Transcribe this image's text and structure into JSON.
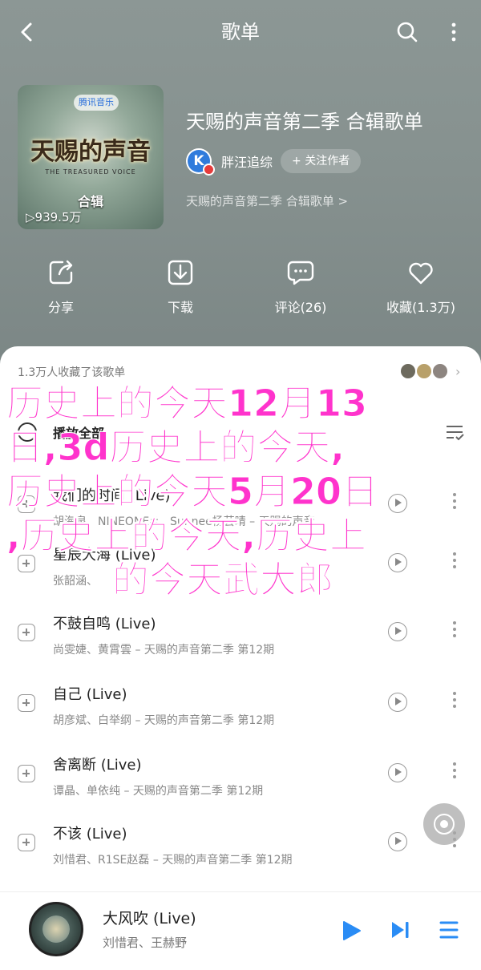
{
  "header": {
    "title": "歌单",
    "back_icon": "back-arrow-icon",
    "search_icon": "search-icon",
    "more_icon": "more-vertical-icon"
  },
  "playlist": {
    "cover": {
      "logo_text": "腾讯音乐",
      "show_title": "天赐的声音",
      "subtitle": "THE TREASURED VOICE",
      "collection": "合辑",
      "plays": "939.5万"
    },
    "title": "天赐的声音第二季 合辑歌单",
    "author_name": "胖汪追综",
    "follow_label": "+ 关注作者",
    "description": "天赐的声音第二季 合辑歌单 >"
  },
  "actions": [
    {
      "label": "分享",
      "icon": "share-icon"
    },
    {
      "label": "下载",
      "icon": "download-icon"
    },
    {
      "label": "评论(26)",
      "icon": "comment-icon"
    },
    {
      "label": "收藏(1.3万)",
      "icon": "heart-icon"
    }
  ],
  "sheet": {
    "favorited_text": "1.3万人收藏了该歌单",
    "chevron": "›",
    "play_all_label": "播放全部"
  },
  "songs": [
    {
      "title": "",
      "subtitle": ""
    },
    {
      "title": "我们的时间 (Live)",
      "subtitle": "胡海泉、NINEONE#、Sunnee杨芸晴 – 天赐的声音"
    },
    {
      "title": "星辰大海 (Live)",
      "subtitle": "张韶涵、"
    },
    {
      "title": "不鼓自鸣 (Live)",
      "subtitle": "尚雯婕、黄霄雲 – 天赐的声音第二季 第12期"
    },
    {
      "title": "自己 (Live)",
      "subtitle": "胡彦斌、白举纲 – 天赐的声音第二季 第12期"
    },
    {
      "title": "舍离断 (Live)",
      "subtitle": "谭晶、单依纯 – 天赐的声音第二季 第12期"
    },
    {
      "title": "不该 (Live)",
      "subtitle": "刘惜君、R1SE赵磊 – 天赐的声音第二季 第12期"
    }
  ],
  "now_playing": {
    "title": "大风吹 (Live)",
    "artists": "刘惜君、王赫野"
  },
  "overlay": {
    "lines": [
      "历史上的今天12月13",
      "日,3d历史上的今天,",
      "历史上的今天5月20日",
      ",历史上的今天,历史上",
      "的今天武大郎"
    ]
  },
  "colors": {
    "accent": "#2a8cf5",
    "overlay_text": "#ff33cc",
    "hero_bg": "#8a9593"
  }
}
